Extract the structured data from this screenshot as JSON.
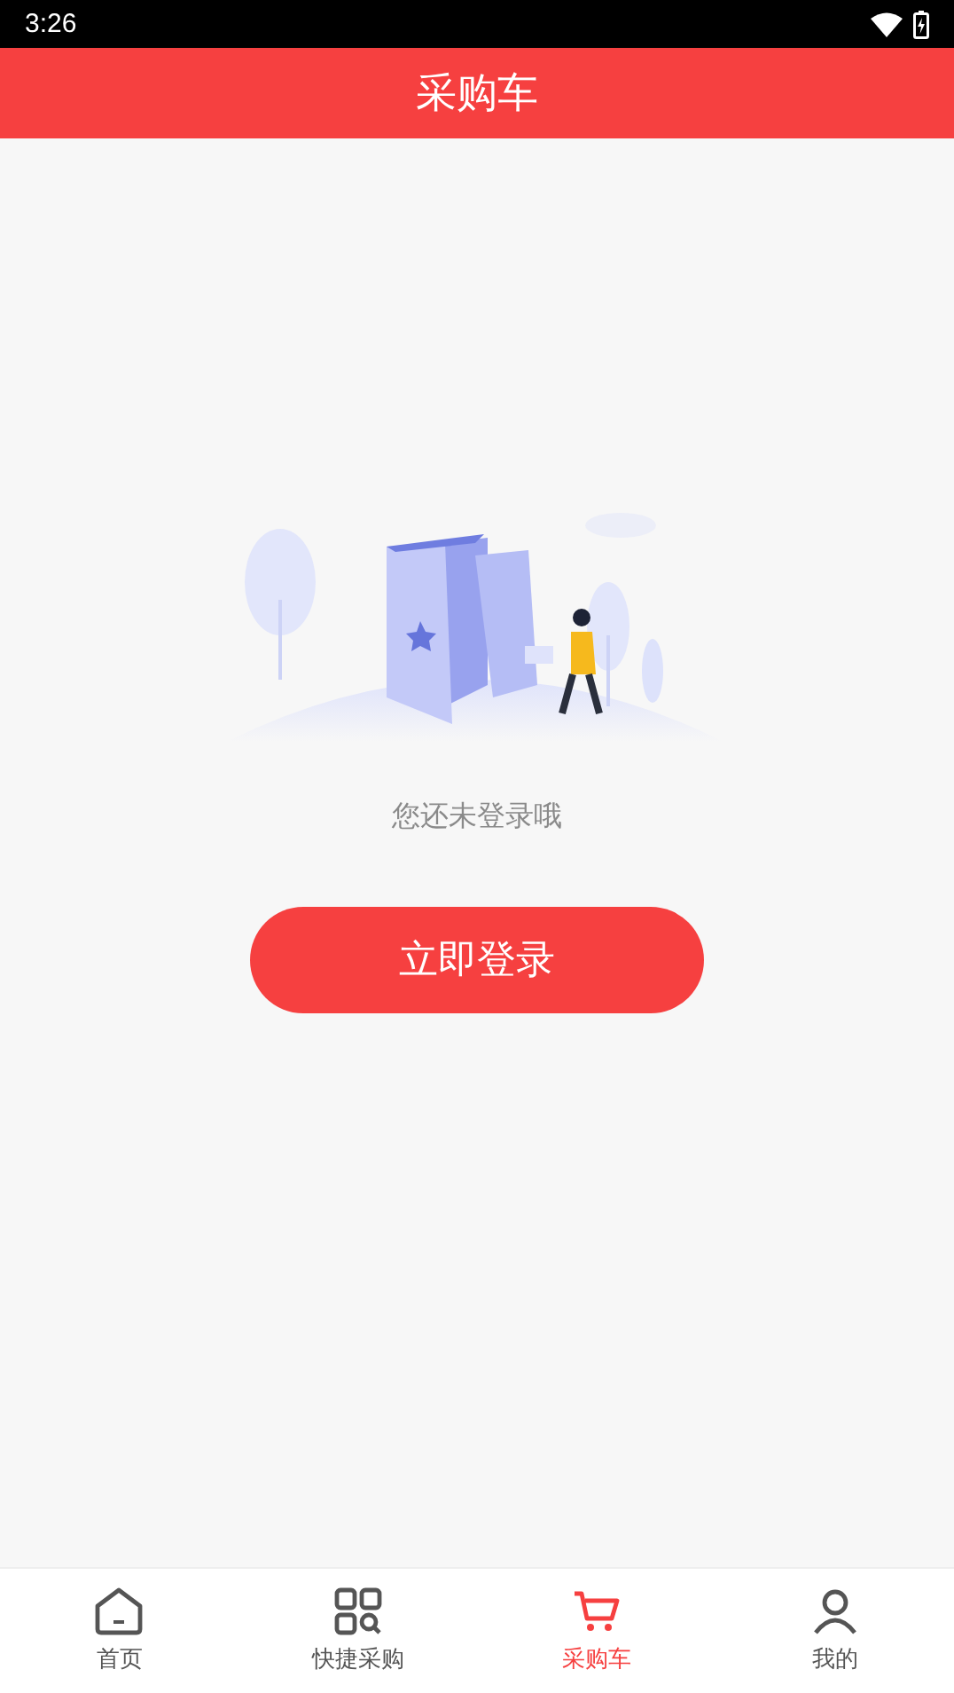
{
  "status_bar": {
    "time": "3:26"
  },
  "header": {
    "title": "采购车"
  },
  "empty_state": {
    "message": "您还未登录哦",
    "button": "立即登录"
  },
  "tab_bar": [
    {
      "label": "首页",
      "kind": "home",
      "selected": false
    },
    {
      "label": "快捷采购",
      "kind": "grid",
      "selected": false
    },
    {
      "label": "采购车",
      "kind": "cart",
      "selected": true
    },
    {
      "label": "我的",
      "kind": "user",
      "selected": false
    }
  ]
}
